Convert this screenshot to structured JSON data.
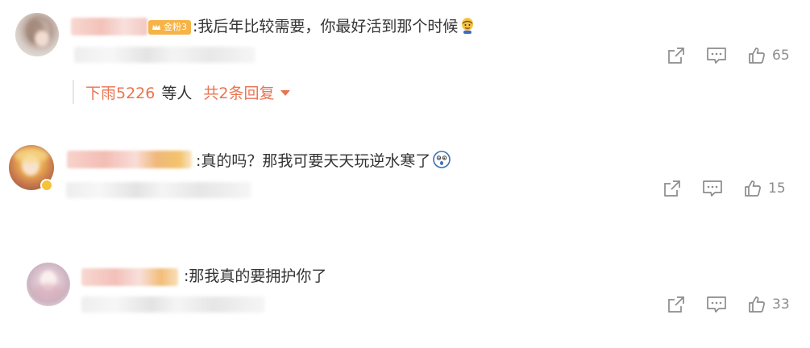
{
  "comments": [
    {
      "badge": "金粉3",
      "text": ":我后年比较需要，你最好活到那个时候",
      "emoji": "smug-face-emoji",
      "likes": "65",
      "replies": {
        "names": "下雨5226",
        "etc": "等人",
        "total": "共2条回复"
      }
    },
    {
      "text": ":真的吗？那我可要天天玩逆水寒了",
      "emoji": "shocked-face-emoji",
      "likes": "15"
    },
    {
      "text": ":那我真的要拥护你了",
      "likes": "33"
    }
  ],
  "icons": {
    "share": "share-icon",
    "comment": "comment-icon",
    "like": "thumbs-up-icon"
  },
  "colors": {
    "accent": "#eb7350",
    "badge": "#f6b346",
    "icon": "#8c8c8c",
    "text": "#333333"
  }
}
